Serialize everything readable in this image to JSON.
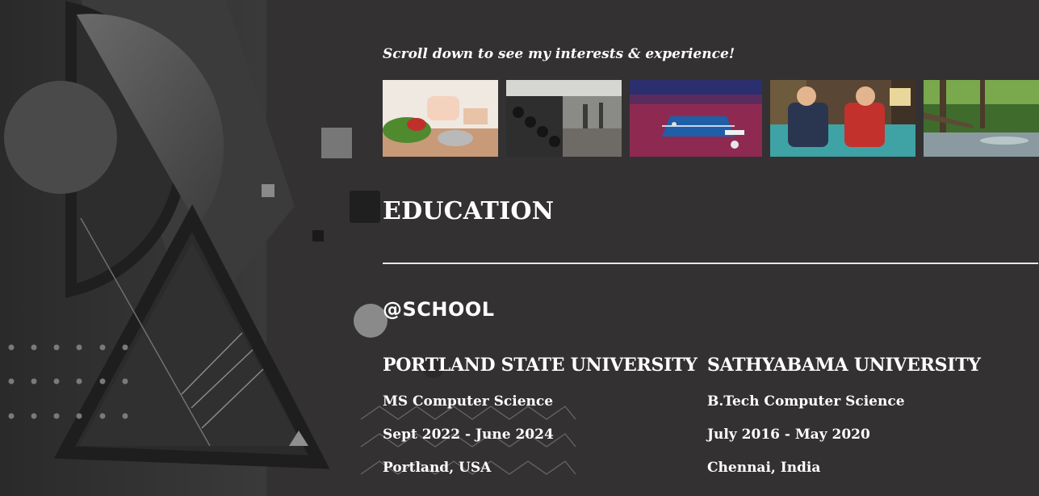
{
  "intro": {
    "scroll_hint": "Scroll down to see my interests & experience!"
  },
  "interests": [
    {
      "icon": "cooking-photo"
    },
    {
      "icon": "gym-photo"
    },
    {
      "icon": "table-tennis-photo"
    },
    {
      "icon": "gaming-photo"
    },
    {
      "icon": "nature-photo"
    }
  ],
  "education": {
    "title": "EDUCATION",
    "tag": "@SCHOOL",
    "schools": [
      {
        "name": "PORTLAND STATE UNIVERSITY",
        "degree": "MS Computer Science",
        "dates": "Sept 2022 - June 2024",
        "location": "Portland, USA"
      },
      {
        "name": "SATHYABAMA UNIVERSITY",
        "degree": "B.Tech Computer Science",
        "dates": "July 2016 - May 2020",
        "location": "Chennai, India"
      }
    ]
  },
  "colors": {
    "background": "#333132",
    "text": "#ffffff",
    "divider": "#e8e8e8"
  }
}
